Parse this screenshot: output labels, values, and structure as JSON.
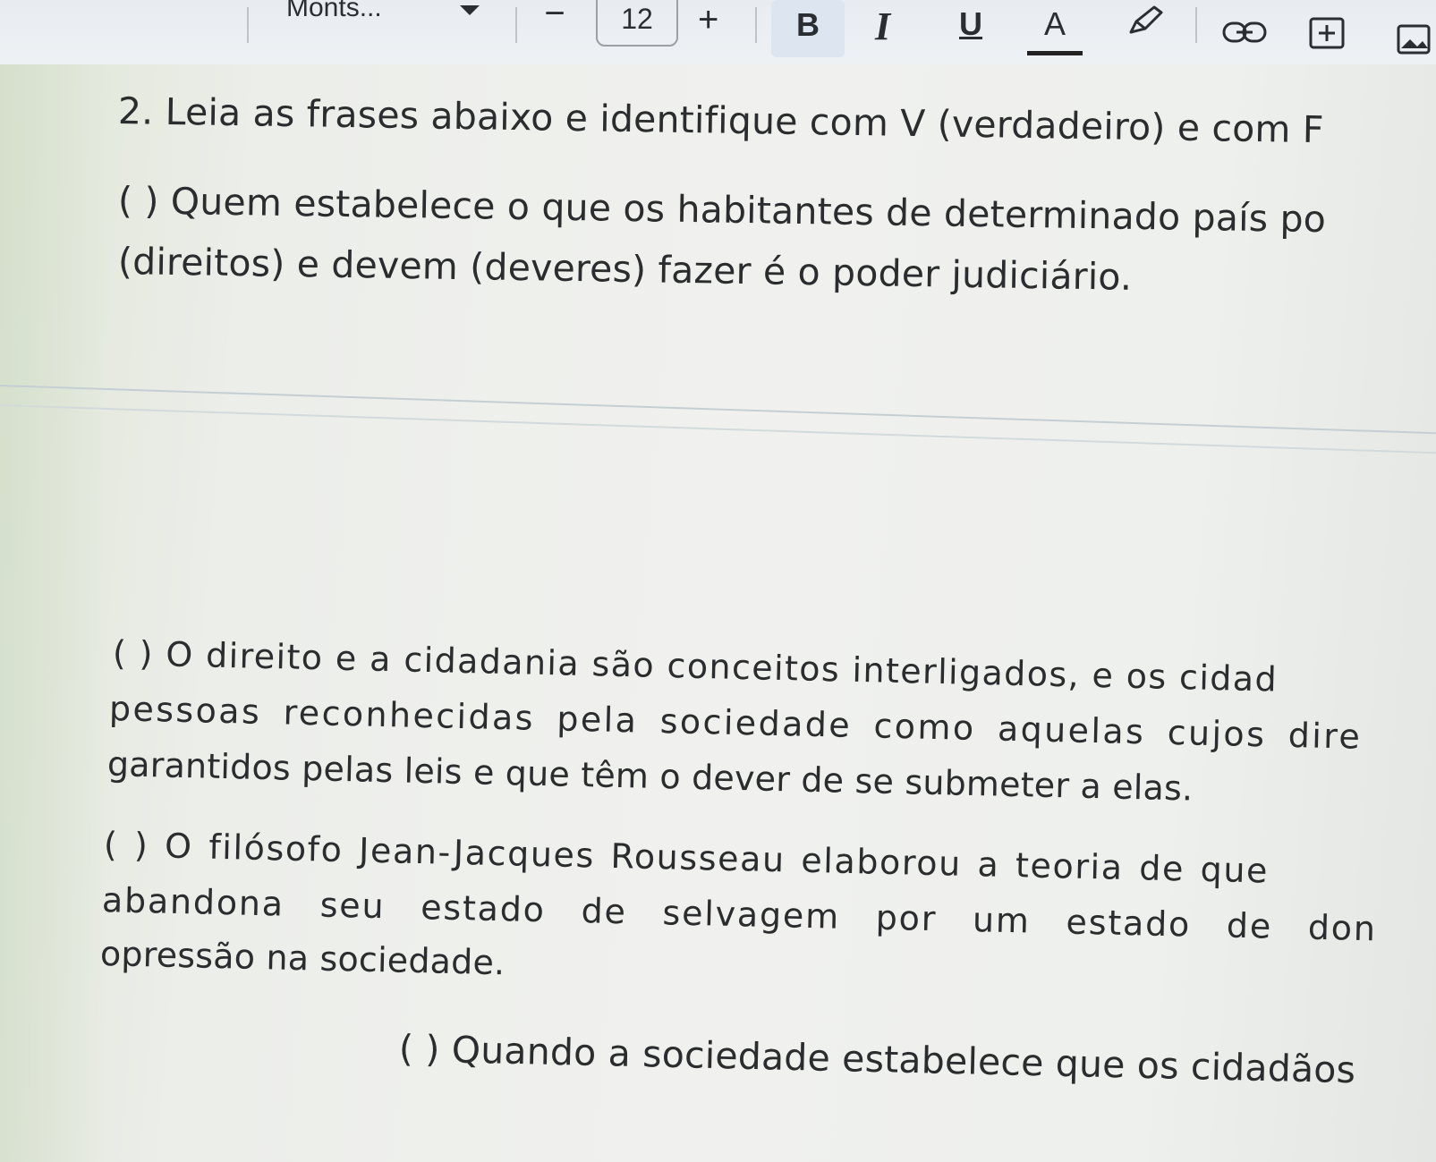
{
  "toolbar": {
    "font_name": "Monts...",
    "decrease_label": "−",
    "font_size": "12",
    "increase_label": "+",
    "bold_label": "B",
    "italic_label": "I",
    "underline_label": "U",
    "text_color_label": "A",
    "text_color": "#222222",
    "icons": [
      "chevron-down-icon",
      "highlighter-pen-icon",
      "link-icon",
      "insert-plus-icon",
      "image-icon"
    ]
  },
  "document": {
    "question_title": "2. Leia as frases abaixo e identifique com V (verdadeiro) e com F",
    "item1": {
      "line1": "( ) Quem estabelece o que os habitantes de determinado país po",
      "line2": "(direitos) e devem (deveres) fazer é o poder judiciário."
    },
    "item2": {
      "line1": "( ) O direito e a cidadania são conceitos interligados, e os cidad",
      "line2": "pessoas reconhecidas pela sociedade como aquelas cujos dire",
      "line3": "garantidos pelas leis e que têm o dever de se submeter a elas."
    },
    "item3": {
      "line1": "( ) O filósofo Jean-Jacques Rousseau elaborou a teoria de que",
      "line2": "abandona seu estado de selvagem por um estado de don",
      "line3": "opressão na sociedade."
    },
    "item4": {
      "line1": "( ) Quando a sociedade estabelece que os cidadãos"
    }
  }
}
